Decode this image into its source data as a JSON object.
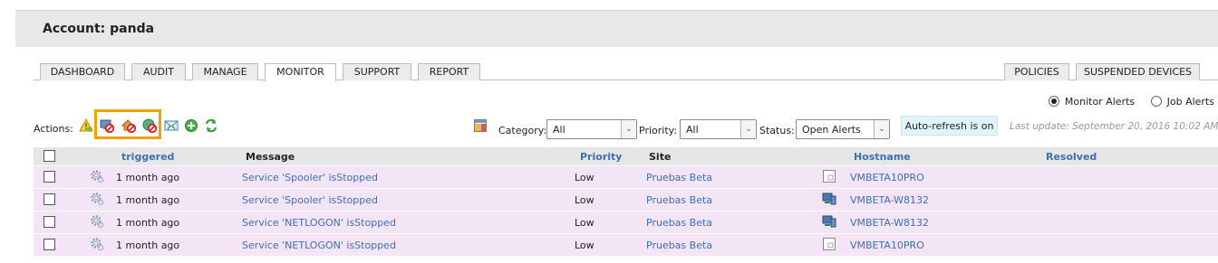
{
  "header": {
    "title": "Account: panda"
  },
  "tabs_left": [
    {
      "label": "DASHBOARD"
    },
    {
      "label": "AUDIT"
    },
    {
      "label": "MANAGE"
    },
    {
      "label": "MONITOR",
      "active": true
    },
    {
      "label": "SUPPORT"
    },
    {
      "label": "REPORT"
    }
  ],
  "tabs_right": [
    {
      "label": "POLICIES"
    },
    {
      "label": "SUSPENDED DEVICES"
    }
  ],
  "view_options": {
    "monitor_alerts": "Monitor Alerts",
    "job_alerts": "Job Alerts",
    "selected": "monitor_alerts"
  },
  "actions": {
    "label": "Actions:",
    "icons": [
      "warning-icon",
      "suspend-device-icon",
      "suspend-home-icon",
      "suspend-globe-icon",
      "email-icon",
      "add-icon",
      "refresh-icon"
    ],
    "highlight_color": "#f2a200"
  },
  "filters": {
    "category_label": "Category:",
    "category_value": "All",
    "priority_label": "Priority:",
    "priority_value": "All",
    "status_label": "Status:",
    "status_value": "Open Alerts"
  },
  "autorefresh": "Auto-refresh is on",
  "last_update": "Last update: September 20, 2016 10:02 AM",
  "table": {
    "columns": {
      "triggered": "triggered",
      "message": "Message",
      "priority": "Priority",
      "site": "Site",
      "hostname": "Hostname",
      "resolved": "Resolved"
    },
    "rows": [
      {
        "triggered": "1 month ago",
        "message": "Service 'Spooler' isStopped",
        "priority": "Low",
        "site": "Pruebas Beta",
        "hostname": "VMBETA10PRO",
        "host_icon": "server-icon"
      },
      {
        "triggered": "1 month ago",
        "message": "Service 'Spooler' isStopped",
        "priority": "Low",
        "site": "Pruebas Beta",
        "hostname": "VMBETA-W8132",
        "host_icon": "workstation-icon"
      },
      {
        "triggered": "1 month ago",
        "message": "Service 'NETLOGON' isStopped",
        "priority": "Low",
        "site": "Pruebas Beta",
        "hostname": "VMBETA-W8132",
        "host_icon": "workstation-icon"
      },
      {
        "triggered": "1 month ago",
        "message": "Service 'NETLOGON' isStopped",
        "priority": "Low",
        "site": "Pruebas Beta",
        "hostname": "VMBETA10PRO",
        "host_icon": "server-icon"
      }
    ]
  },
  "colors": {
    "link": "#3d6fb6",
    "row_bg": "#f3e4f6",
    "header_bg": "#e6e6e6"
  }
}
